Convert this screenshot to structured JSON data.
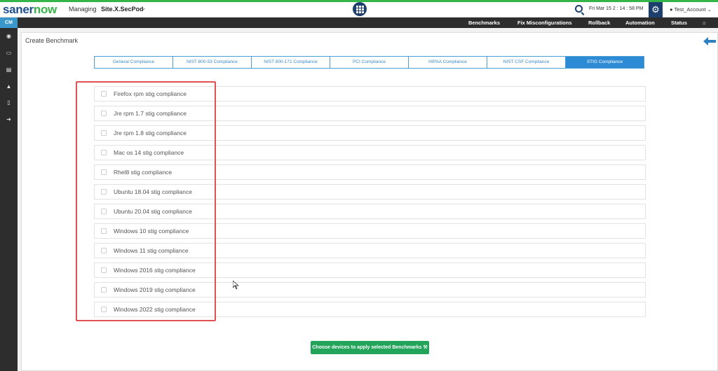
{
  "header": {
    "logo_saner": "saner",
    "logo_now": "now",
    "managing_label": "Managing",
    "site_name": "Site.X.SecPod",
    "datetime": "Fri Mar 15  2 : 14 : 58 PM",
    "account": "Test_Account"
  },
  "nav": {
    "cm_label": "CM",
    "items": [
      "Benchmarks",
      "Fix Misconfigurations",
      "Rollback",
      "Automation",
      "Status"
    ]
  },
  "page": {
    "title": "Create Benchmark"
  },
  "tabs": [
    {
      "label": "General Compliance",
      "active": false
    },
    {
      "label": "NIST 800-53 Compliance",
      "active": false
    },
    {
      "label": "NIST 800-171 Compliance",
      "active": false
    },
    {
      "label": "PCI Compliance",
      "active": false
    },
    {
      "label": "HIPAA Compliance",
      "active": false
    },
    {
      "label": "NIST CSF Compliance",
      "active": false
    },
    {
      "label": "STIG Compliance",
      "active": true
    }
  ],
  "benchmarks": [
    {
      "label": "Firefox rpm stig compliance",
      "checked": false
    },
    {
      "label": "Jre rpm 1.7 stig compliance",
      "checked": false
    },
    {
      "label": "Jre rpm 1.8 stig compliance",
      "checked": false
    },
    {
      "label": "Mac os 14 stig compliance",
      "checked": false
    },
    {
      "label": "Rhel8 stig compliance",
      "checked": false
    },
    {
      "label": "Ubuntu 18.04 stig compliance",
      "checked": false
    },
    {
      "label": "Ubuntu 20.04 stig compliance",
      "checked": false
    },
    {
      "label": "Windows 10 stig compliance",
      "checked": false
    },
    {
      "label": "Windows 11 stig compliance",
      "checked": false
    },
    {
      "label": "Windows 2016 stig compliance",
      "checked": false
    },
    {
      "label": "Windows 2019 stig compliance",
      "checked": false
    },
    {
      "label": "Windows 2022 stig compliance",
      "checked": false
    }
  ],
  "apply_button": "Choose devices to apply selected Benchmarks",
  "colors": {
    "brand_blue": "#1d4f8c",
    "brand_green": "#35b44a",
    "tab_active": "#2d8bd6",
    "apply_green": "#22a55a",
    "highlight_red": "#e05252"
  },
  "icons": [
    "grid-icon",
    "search-icon",
    "gear-icon",
    "user-icon",
    "home-icon",
    "back-arrow-icon",
    "eye-icon",
    "monitor-icon",
    "list-icon",
    "warning-icon",
    "book-icon",
    "logout-icon",
    "wrench-icon"
  ]
}
